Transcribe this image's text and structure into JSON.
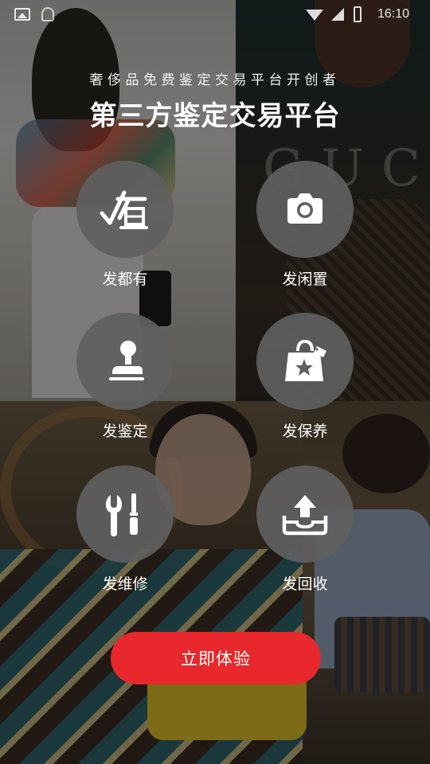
{
  "status_bar": {
    "time": "16:10",
    "icons": [
      "gallery-icon",
      "notification-icon",
      "wifi-icon",
      "signal-icon",
      "battery-icon"
    ]
  },
  "header": {
    "subtitle": "奢侈品免费鉴定交易平台开创者",
    "title": "第三方鉴定交易平台"
  },
  "features": [
    {
      "label": "发都有",
      "icon": "duyou-logo-icon"
    },
    {
      "label": "发闲置",
      "icon": "camera-icon"
    },
    {
      "label": "发鉴定",
      "icon": "stamp-icon"
    },
    {
      "label": "发保养",
      "icon": "shopping-bag-star-icon"
    },
    {
      "label": "发维修",
      "icon": "wrench-screwdriver-icon"
    },
    {
      "label": "发回收",
      "icon": "upload-tray-icon"
    }
  ],
  "cta": {
    "label": "立即体验",
    "color": "#e8282c"
  },
  "background": {
    "brand_watermark": "GUCCI"
  }
}
